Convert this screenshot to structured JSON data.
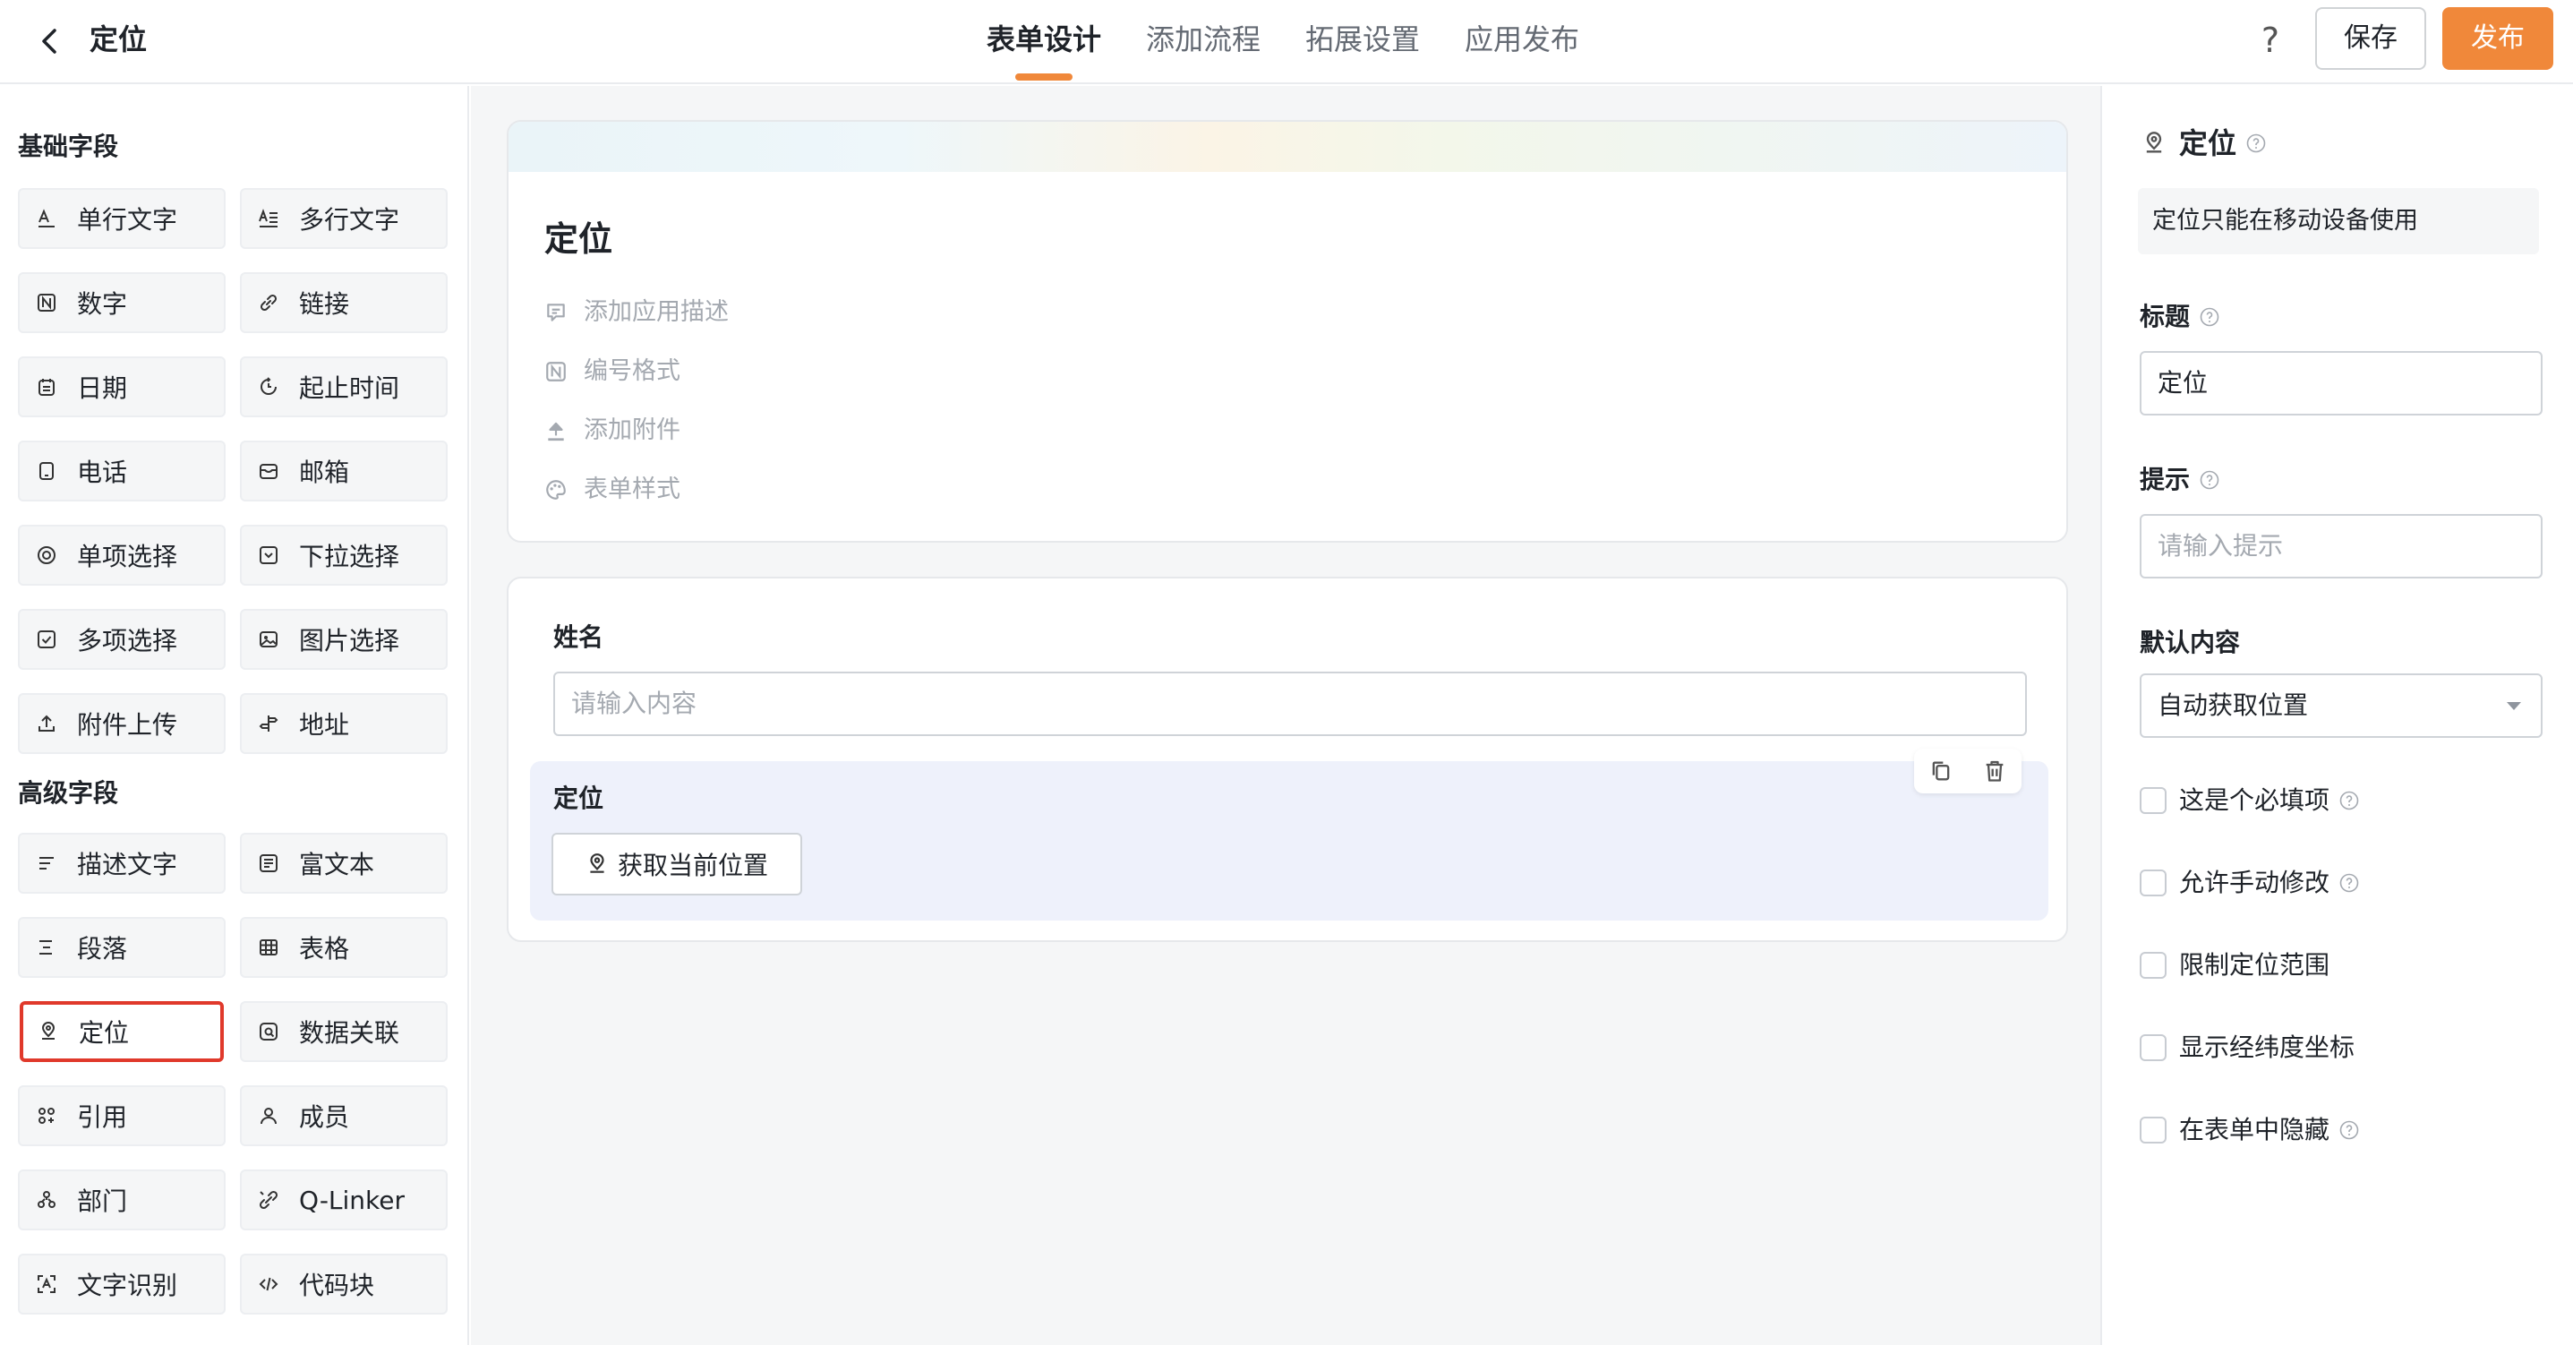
{
  "header": {
    "title": "定位",
    "tabs": [
      {
        "label": "表单设计",
        "active": true
      },
      {
        "label": "添加流程",
        "active": false
      },
      {
        "label": "拓展设置",
        "active": false
      },
      {
        "label": "应用发布",
        "active": false
      }
    ],
    "help_label": "?",
    "save_label": "保存",
    "publish_label": "发布"
  },
  "left_panel": {
    "basic_title": "基础字段",
    "basic_fields": [
      {
        "label": "单行文字",
        "icon": "single-line-text-icon"
      },
      {
        "label": "多行文字",
        "icon": "multi-line-text-icon"
      },
      {
        "label": "数字",
        "icon": "number-icon"
      },
      {
        "label": "链接",
        "icon": "link-icon"
      },
      {
        "label": "日期",
        "icon": "calendar-icon"
      },
      {
        "label": "起止时间",
        "icon": "time-range-icon"
      },
      {
        "label": "电话",
        "icon": "phone-icon"
      },
      {
        "label": "邮箱",
        "icon": "mail-icon"
      },
      {
        "label": "单项选择",
        "icon": "radio-icon"
      },
      {
        "label": "下拉选择",
        "icon": "dropdown-icon"
      },
      {
        "label": "多项选择",
        "icon": "checkbox-icon"
      },
      {
        "label": "图片选择",
        "icon": "image-icon"
      },
      {
        "label": "附件上传",
        "icon": "upload-icon"
      },
      {
        "label": "地址",
        "icon": "address-icon"
      }
    ],
    "advanced_title": "高级字段",
    "advanced_fields": [
      {
        "label": "描述文字",
        "icon": "description-icon"
      },
      {
        "label": "富文本",
        "icon": "rich-text-icon"
      },
      {
        "label": "段落",
        "icon": "paragraph-icon"
      },
      {
        "label": "表格",
        "icon": "table-icon"
      },
      {
        "label": "定位",
        "icon": "location-icon",
        "selected": true
      },
      {
        "label": "数据关联",
        "icon": "data-link-icon"
      },
      {
        "label": "引用",
        "icon": "reference-icon"
      },
      {
        "label": "成员",
        "icon": "member-icon"
      },
      {
        "label": "部门",
        "icon": "department-icon"
      },
      {
        "label": "Q-Linker",
        "icon": "q-linker-icon"
      },
      {
        "label": "文字识别",
        "icon": "ocr-icon"
      },
      {
        "label": "代码块",
        "icon": "code-icon"
      }
    ]
  },
  "canvas": {
    "form_title": "定位",
    "meta_items": [
      {
        "label": "添加应用描述",
        "icon": "comment-icon"
      },
      {
        "label": "编号格式",
        "icon": "number-format-icon"
      },
      {
        "label": "添加附件",
        "icon": "upload-icon"
      },
      {
        "label": "表单样式",
        "icon": "palette-icon"
      }
    ],
    "name_field": {
      "label": "姓名",
      "placeholder": "请输入内容"
    },
    "location_field": {
      "label": "定位",
      "button_label": "获取当前位置"
    }
  },
  "right_panel": {
    "title": "定位",
    "note": "定位只能在移动设备使用",
    "title_label": "标题",
    "title_value": "定位",
    "hint_label": "提示",
    "hint_placeholder": "请输入提示",
    "default_label": "默认内容",
    "default_value": "自动获取位置",
    "options": [
      {
        "label": "这是个必填项",
        "checked": false,
        "has_help": true
      },
      {
        "label": "允许手动修改",
        "checked": false,
        "has_help": true
      },
      {
        "label": "限制定位范围",
        "checked": false,
        "has_help": false
      },
      {
        "label": "显示经纬度坐标",
        "checked": false,
        "has_help": false
      },
      {
        "label": "在表单中隐藏",
        "checked": false,
        "has_help": true
      }
    ]
  },
  "colors": {
    "accent": "#f0883a",
    "selected_border": "#e0392b",
    "selected_field_bg": "#eef1fb"
  }
}
